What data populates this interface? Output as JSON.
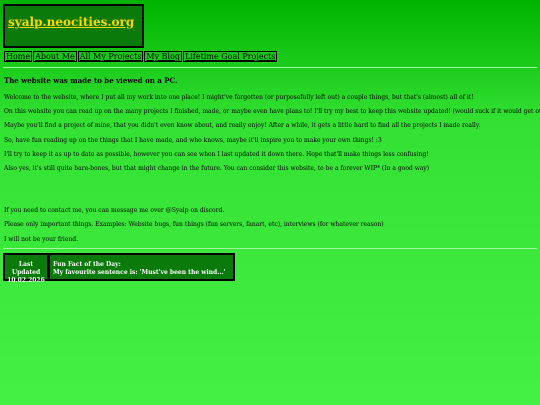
{
  "site": {
    "title": "syalp.neocities.org"
  },
  "nav": [
    "Home",
    "About Me",
    "All My Projects",
    "My Blog",
    "Lifetime Goal Projects"
  ],
  "main": {
    "heading": "The website was made to be viewed on a PC.",
    "paragraphs": [
      "Welcome to the website, where I put all my work into one place! I might've forgotten (or purposefully left out) a couple things, but that's (almost) all of it!",
      "On this website you can read up on the many projects I finished, made, or maybe even have plans to! I'll try my best to keep this website updated! (would suck if it would get outdated)",
      "Maybe you'll find a project of mine, that you didn't even know about, and really enjoy! After a while, it gets a little hard to find all the projects I made really.",
      "So, have fun reading up on the things that I have made, and who knows, maybe it'll inspire you to make your own things! :3",
      "I'll try to keep it as up to date as possible, however you can see when I last updated it down there. Hope that'll make things less confusing!",
      "Also yes, it's still quite bare-bones, but that might change in the future. You can consider this website, to be a forever WIP* (In a good way)"
    ],
    "contact": [
      "If you need to contact me, you can message me over @Syalp on discord.",
      "Please only important things. Examples: Website bugs, fun things (fun servers, fanart, etc), interviews (for whatever reason)",
      "I will not be your friend."
    ]
  },
  "footer": {
    "last_updated_label": "Last Updated",
    "last_updated_date": "10.02.2026",
    "fun_fact_label": "Fun Fact of the Day:",
    "fun_fact_text": "My favourite sentence is: 'Must've been the wind...'"
  },
  "colors": {
    "background": "#33e133",
    "box": "#0a7a0a",
    "title": "#ffd700"
  }
}
